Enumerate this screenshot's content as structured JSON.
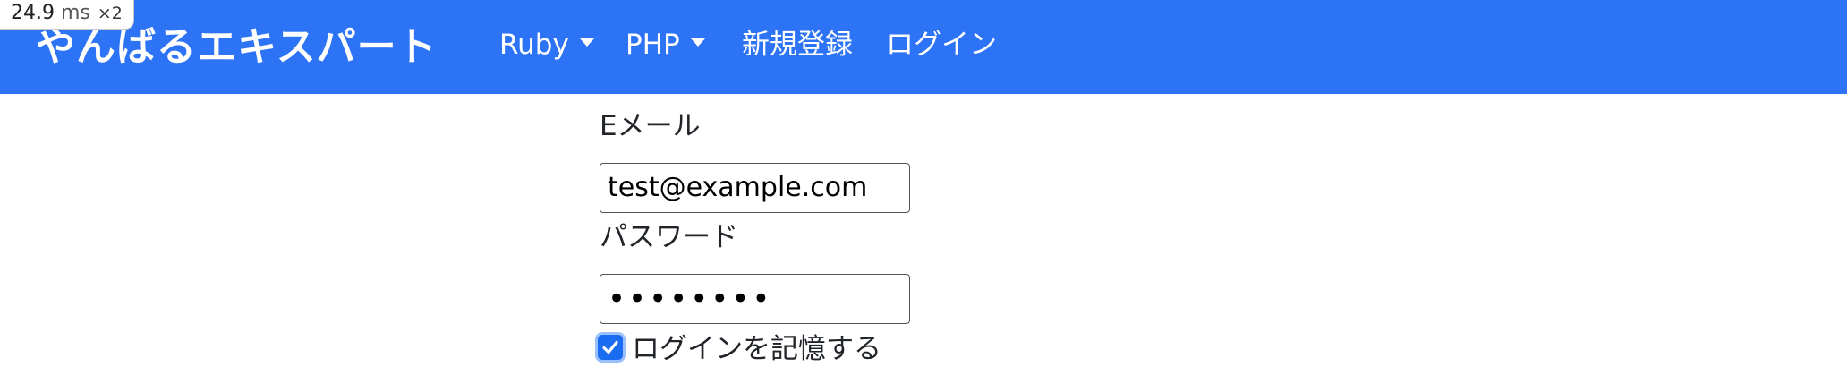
{
  "navbar": {
    "brand": "やんばるエキスパート",
    "items": [
      {
        "label": "Ruby",
        "has_dropdown": true
      },
      {
        "label": "PHP",
        "has_dropdown": true
      },
      {
        "label": "新規登録",
        "has_dropdown": false
      },
      {
        "label": "ログイン",
        "has_dropdown": false
      }
    ],
    "background_color": "#2d73f5"
  },
  "perf_badge": {
    "value": "24.9",
    "unit": "ms",
    "multiplier": "×2"
  },
  "form": {
    "email_label": "Eメール",
    "email_value": "test@example.com",
    "password_label": "パスワード",
    "password_value": "••••••••",
    "remember_label": "ログインを記憶する",
    "remember_checked": true
  }
}
